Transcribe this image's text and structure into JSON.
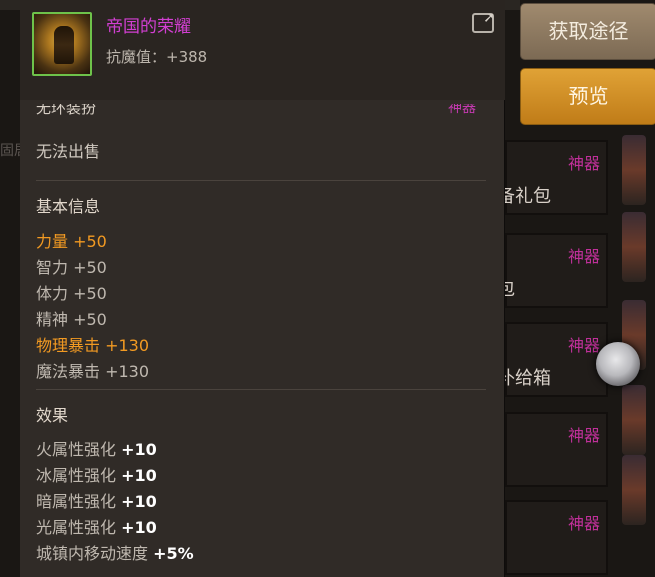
{
  "buttons": {
    "source": "获取途径",
    "preview": "预览"
  },
  "item": {
    "name": "帝国的荣耀",
    "stat_label": "抗魔值",
    "stat_value": "：+388",
    "cut_line": "无环装扮",
    "cut_tag": "神器",
    "no_sale": "无法出售"
  },
  "basic": {
    "title": "基本信息",
    "attrs": [
      {
        "text": "力量 +50",
        "highlight": true
      },
      {
        "text": "智力 +50",
        "highlight": false
      },
      {
        "text": "体力 +50",
        "highlight": false
      },
      {
        "text": "精神 +50",
        "highlight": false
      },
      {
        "text": "物理暴击 +130",
        "highlight": true
      },
      {
        "text": "魔法暴击 +130",
        "highlight": false
      }
    ]
  },
  "effects": {
    "title": "效果",
    "list": [
      {
        "label": "火属性强化 ",
        "value": "+10"
      },
      {
        "label": "冰属性强化 ",
        "value": "+10"
      },
      {
        "label": "暗属性强化 ",
        "value": "+10"
      },
      {
        "label": "光属性强化 ",
        "value": "+10"
      },
      {
        "label": "城镇内移动速度 ",
        "value": "+5%"
      }
    ]
  },
  "background_rows": [
    {
      "tag": "神器",
      "partial": "备礼包"
    },
    {
      "tag": "神器",
      "partial": "包"
    },
    {
      "tag": "神器",
      "partial": "补给箱"
    },
    {
      "tag": "神器",
      "partial": ""
    },
    {
      "tag": "神器",
      "partial": ""
    }
  ],
  "background_left_text": "固居",
  "colors": {
    "artifact": "#c0309a",
    "highlight": "#f29a22",
    "item_name": "#d23fd2",
    "icon_border": "#6ec24a"
  }
}
